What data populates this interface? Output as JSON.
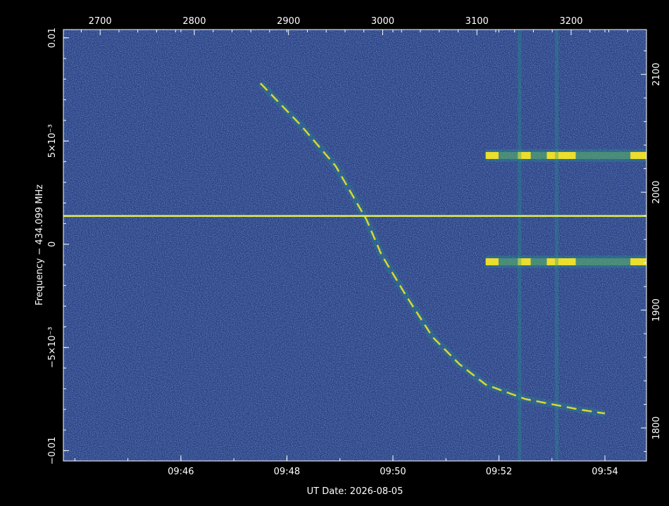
{
  "chart_data": {
    "type": "heatmap",
    "title": "",
    "xlabel": "UT Date: 2026-08-05",
    "ylabel": "Frequency − 434.099 MHz",
    "x_bottom": {
      "unit": "UT time",
      "range": [
        "09:43:47",
        "09:54:47"
      ],
      "ticks": [
        {
          "value": "09:46:00",
          "label": "09:46"
        },
        {
          "value": "09:48:00",
          "label": "09:48"
        },
        {
          "value": "09:50:00",
          "label": "09:50"
        },
        {
          "value": "09:52:00",
          "label": "09:52"
        },
        {
          "value": "09:54:00",
          "label": "09:54"
        }
      ]
    },
    "x_top": {
      "range": [
        2661,
        3280
      ],
      "ticks": [
        {
          "value": 2700,
          "label": "2700"
        },
        {
          "value": 2800,
          "label": "2800"
        },
        {
          "value": 2900,
          "label": "2900"
        },
        {
          "value": 3000,
          "label": "3000"
        },
        {
          "value": 3100,
          "label": "3100"
        },
        {
          "value": 3200,
          "label": "3200"
        }
      ]
    },
    "y_left": {
      "range": [
        -0.0105,
        0.0104
      ],
      "ticks": [
        {
          "value": 0.01,
          "label": "0.01"
        },
        {
          "value": 0.005,
          "label": "5×10⁻³"
        },
        {
          "value": 0,
          "label": "0"
        },
        {
          "value": -0.005,
          "label": "−5×10⁻³"
        },
        {
          "value": -0.01,
          "label": "−0.01"
        }
      ]
    },
    "y_right": {
      "range": [
        1772,
        2138
      ],
      "ticks": [
        {
          "value": 2100,
          "label": "2100"
        },
        {
          "value": 2000,
          "label": "2000"
        },
        {
          "value": 1900,
          "label": "1900"
        },
        {
          "value": 1800,
          "label": "1800"
        }
      ]
    },
    "colormap": [
      "#2c3c8a",
      "#2b5c8e",
      "#21918c",
      "#7ad151",
      "#fde725"
    ],
    "features": {
      "carrier_line": {
        "frequency": 0.00137,
        "color": "#e8f04a"
      },
      "interference_bands": [
        {
          "frequency": 0.0043,
          "time_range": [
            "09:51:45",
            "09:54:47"
          ]
        },
        {
          "frequency": -0.00085,
          "time_range": [
            "09:51:45",
            "09:54:47"
          ]
        }
      ],
      "doppler_track": [
        {
          "time": "09:47:30",
          "frequency": 0.0078
        },
        {
          "time": "09:48:15",
          "frequency": 0.0058
        },
        {
          "time": "09:48:55",
          "frequency": 0.0038
        },
        {
          "time": "09:49:30",
          "frequency": 0.0012
        },
        {
          "time": "09:49:47",
          "frequency": -0.0005
        },
        {
          "time": "09:50:15",
          "frequency": -0.0025
        },
        {
          "time": "09:50:45",
          "frequency": -0.0045
        },
        {
          "time": "09:51:15",
          "frequency": -0.0058
        },
        {
          "time": "09:51:45",
          "frequency": -0.0068
        },
        {
          "time": "09:52:30",
          "frequency": -0.0075
        },
        {
          "time": "09:53:30",
          "frequency": -0.008
        },
        {
          "time": "09:54:00",
          "frequency": -0.0082
        }
      ]
    }
  }
}
